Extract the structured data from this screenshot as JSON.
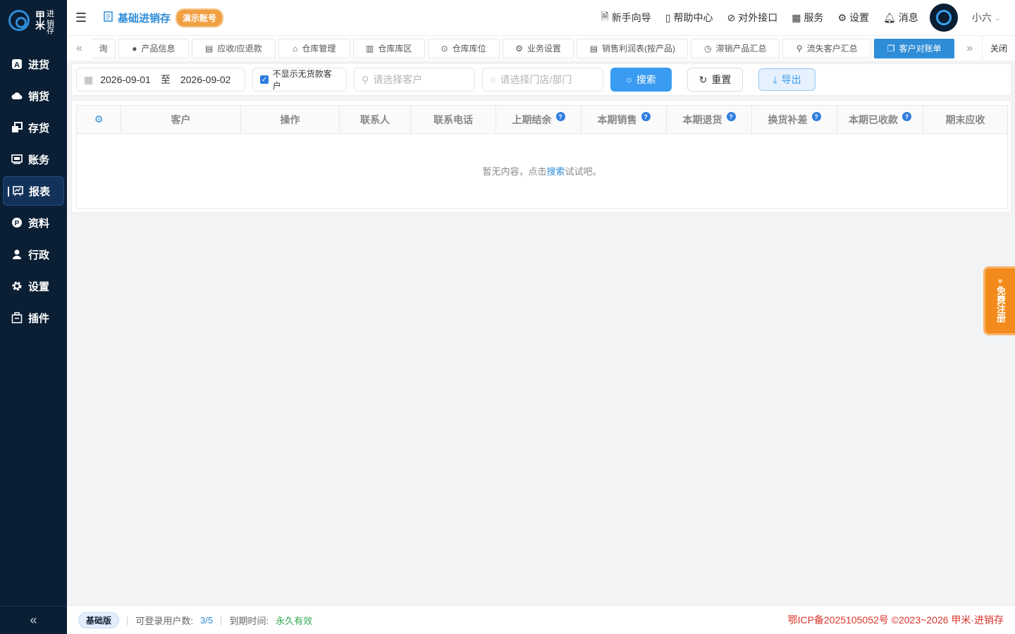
{
  "brand": {
    "line1a": "甲",
    "line1b": "进",
    "line2a": "米",
    "line2b": "销",
    "line3": "存"
  },
  "nav": [
    {
      "label": "进货",
      "icon": "a-box-icon"
    },
    {
      "label": "销货",
      "icon": "cloud-icon"
    },
    {
      "label": "存货",
      "icon": "layers-icon"
    },
    {
      "label": "账务",
      "icon": "ledger-icon"
    },
    {
      "label": "报表",
      "icon": "report-icon",
      "active": true
    },
    {
      "label": "资料",
      "icon": "p-circle-icon"
    },
    {
      "label": "行政",
      "icon": "user-icon"
    },
    {
      "label": "设置",
      "icon": "gear-icon"
    },
    {
      "label": "插件",
      "icon": "plugin-icon"
    }
  ],
  "header": {
    "app_title": "基础进销存",
    "demo_badge": "演示账号",
    "links": {
      "guide": "新手向导",
      "help": "帮助中心",
      "api": "对外接口",
      "service": "服务",
      "settings": "设置",
      "messages": "消息"
    },
    "user": "小六"
  },
  "tabs": {
    "items": [
      "询",
      "产品信息",
      "应收/应退款",
      "仓库管理",
      "仓库库区",
      "仓库库位",
      "业务设置",
      "销售利润表(按产品)",
      "滞销产品汇总",
      "流失客户汇总",
      "客户对账单"
    ],
    "active": "客户对账单",
    "close": "关闭"
  },
  "filter": {
    "date_from": "2026-09-01",
    "date_sep": "至",
    "date_to": "2026-09-02",
    "hide_no_purchase": "不显示无货款客户",
    "hide_no_purchase_checked": true,
    "customer_placeholder": "请选择客户",
    "store_placeholder": "请选择门店/部门",
    "search": "搜索",
    "reset": "重置",
    "export": "导出"
  },
  "table": {
    "columns": [
      "客户",
      "操作",
      "联系人",
      "联系电话",
      "上期结余",
      "本期销售",
      "本期退货",
      "换货补差",
      "本期已收款",
      "期末应收"
    ],
    "empty_prefix": "暂无内容，点击",
    "empty_link": "搜索",
    "empty_suffix": "试试吧。"
  },
  "register": "免费注册",
  "footer": {
    "edition": "基础版",
    "users_label": "可登录用户数:",
    "users_value": "3/5",
    "expire_label": "到期时间:",
    "expire_value": "永久有效",
    "copyright": "鄂ICP备2025105052号 ©2023~2026 甲米·进销存"
  },
  "colors": {
    "sidebar": "#0a1e34",
    "accent": "#3a9cf0",
    "demo_badge": "#f0a042",
    "register": "#f28b1b"
  }
}
